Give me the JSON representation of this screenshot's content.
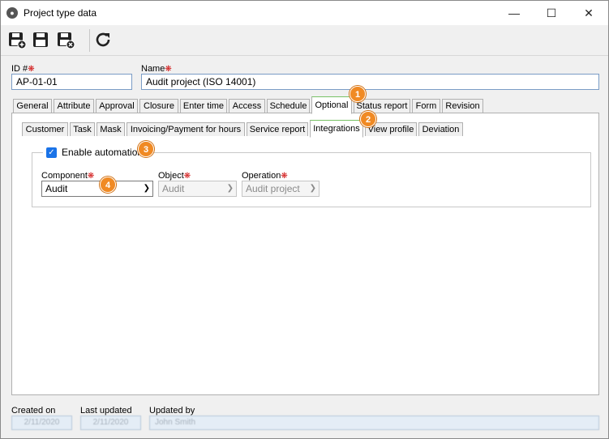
{
  "window": {
    "title": "Project type data",
    "controls": {
      "minimize": "—",
      "maximize": "☐",
      "close": "✕"
    }
  },
  "toolbar": {
    "buttons": [
      {
        "name": "save-new",
        "icon": "save-plus-icon"
      },
      {
        "name": "save",
        "icon": "save-icon"
      },
      {
        "name": "save-close",
        "icon": "save-close-icon"
      },
      {
        "name": "refresh",
        "icon": "refresh-icon"
      }
    ]
  },
  "form": {
    "id_label": "ID #",
    "id_value": "AP-01-01",
    "name_label": "Name",
    "name_value": "Audit project (ISO 14001)"
  },
  "main_tabs": [
    "General",
    "Attribute",
    "Approval",
    "Closure",
    "Enter time",
    "Access",
    "Schedule",
    "Optional",
    "Status report",
    "Form",
    "Revision"
  ],
  "main_tab_active": "Optional",
  "sub_tabs": [
    "Customer",
    "Task",
    "Mask",
    "Invoicing/Payment for hours",
    "Service report",
    "Integrations",
    "View profile",
    "Deviation"
  ],
  "sub_tab_active": "Integrations",
  "automation": {
    "checkbox_label": "Enable automation",
    "checked": true,
    "component_label": "Component",
    "component_value": "Audit",
    "object_label": "Object",
    "object_value": "Audit",
    "operation_label": "Operation",
    "operation_value": "Audit project"
  },
  "callouts": [
    "1",
    "2",
    "3",
    "4"
  ],
  "footer": {
    "created_on_label": "Created on",
    "created_on_value": "2/11/2020",
    "last_updated_label": "Last updated",
    "last_updated_value": "2/11/2020",
    "updated_by_label": "Updated by",
    "updated_by_value": "John Smith"
  },
  "colors": {
    "accent_tab": "#79c266",
    "checkbox": "#1a73e8",
    "required": "#d01010",
    "callout": "#f08a24"
  }
}
